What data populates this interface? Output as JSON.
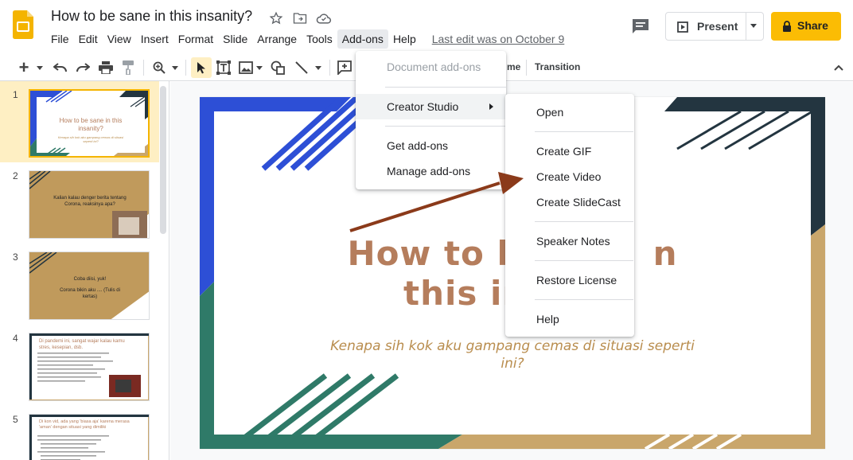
{
  "header": {
    "doc_title": "How to be sane in this insanity?",
    "menu": [
      "File",
      "Edit",
      "View",
      "Insert",
      "Format",
      "Slide",
      "Arrange",
      "Tools",
      "Add-ons",
      "Help"
    ],
    "last_edit": "Last edit was on October 9",
    "present_label": "Present",
    "share_label": "Share"
  },
  "toolbar": {
    "theme_label": "me",
    "transition_label": "Transition"
  },
  "filmstrip": {
    "slides": [
      {
        "num": "1",
        "title": "How to be sane in this insanity?",
        "sub": "Kenapa sih kok aku gampang cemas di situasi seperti ini?"
      },
      {
        "num": "2",
        "text": "Kalian kalau denger berita tentang Corona, reaksinya apa?"
      },
      {
        "num": "3",
        "text1": "Coba diisi, yuk!",
        "text2": "Corona bikin aku .... (Tulis di kertas)"
      },
      {
        "num": "4",
        "title": "Di pandemi ini, sangat wajar kalau kamu stres, kesepian, dsb."
      },
      {
        "num": "5",
        "title": "Di kon vid, ada yang 'biasa aja' karena merasa 'aman' dengan situasi yang dimiliki"
      }
    ]
  },
  "slide": {
    "title_line1": "How to b",
    "title_line1_end": "n",
    "title_line2": "this ins",
    "subtitle": "Kenapa sih kok aku gampang cemas di situasi seperti ini?"
  },
  "addons_menu": {
    "items": [
      "Document add-ons",
      "Creator Studio",
      "Get add-ons",
      "Manage add-ons"
    ]
  },
  "creator_menu": {
    "items": [
      "Open",
      "Create GIF",
      "Create Video",
      "Create SlideCast",
      "Speaker Notes",
      "Restore License",
      "Help"
    ]
  },
  "colors": {
    "accent_yellow": "#fbbc04",
    "slide_blue": "#2d4fd6",
    "slide_green": "#2f7a68",
    "slide_gold": "#c9a66b",
    "slide_dark": "#233540",
    "title_brown": "#b57d5c",
    "arrow": "#8b3a1a"
  }
}
